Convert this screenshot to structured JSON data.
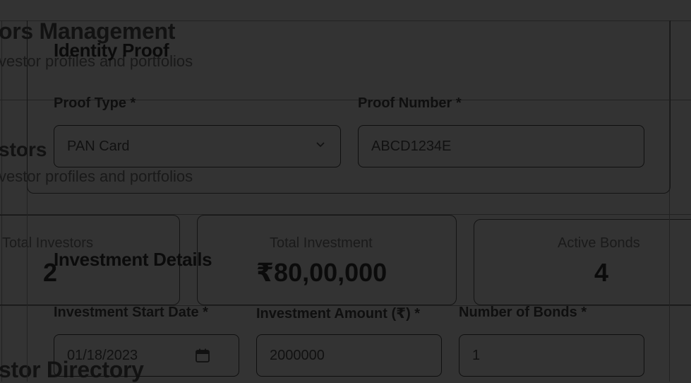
{
  "background_page": {
    "header_title": "ors Management",
    "header_subtitle": "vestor profiles and portfolios",
    "section_title": "stors",
    "section_subtitle": "vestor profiles and portfolios",
    "directory_title": "stor Directory"
  },
  "stats": {
    "total_investors_label": "Total Investors",
    "total_investors_value": "2",
    "total_investment_label": "Total Investment",
    "total_investment_value": "₹80,00,000",
    "active_bonds_label": "Active Bonds",
    "active_bonds_value": "4"
  },
  "identity_proof": {
    "title": "Identity Proof",
    "proof_type_label": "Proof Type *",
    "proof_type_value": "PAN Card",
    "proof_number_label": "Proof Number *",
    "proof_number_value": "ABCD1234E"
  },
  "investment_details": {
    "title": "Investment Details",
    "start_date_label": "Investment Start Date *",
    "start_date_value": "01/18/2023",
    "amount_label": "Investment Amount (₹) *",
    "amount_value": "2000000",
    "bonds_label": "Number of Bonds *",
    "bonds_value": "1"
  },
  "icons": {
    "chevron": "chevron-down-icon",
    "calendar": "calendar-icon"
  }
}
